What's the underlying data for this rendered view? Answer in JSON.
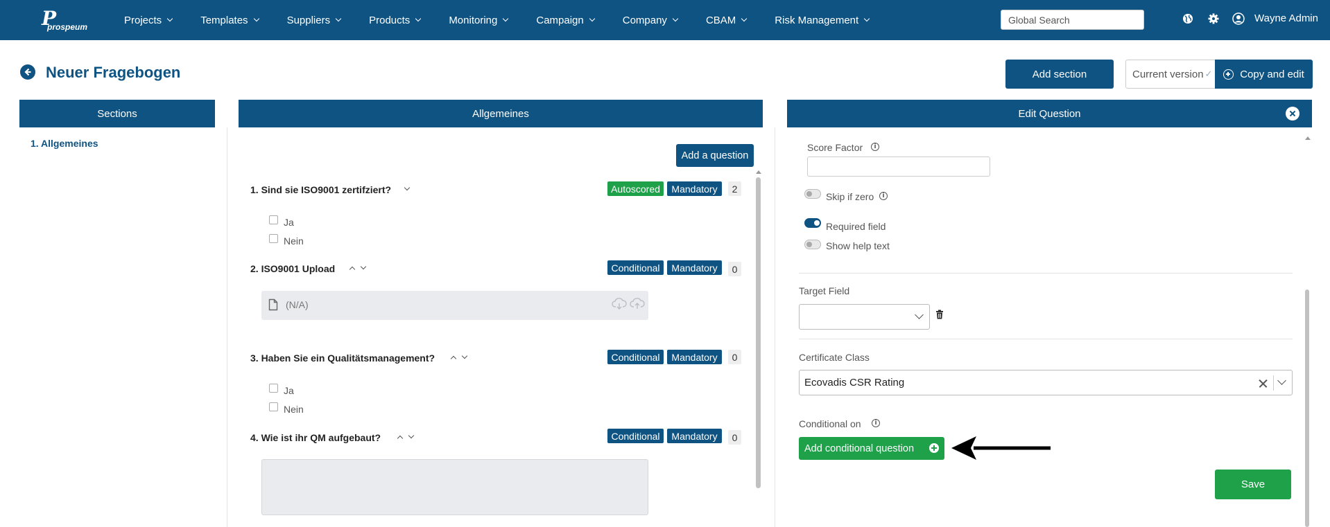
{
  "brand": {
    "logo_mark": "P",
    "logo_word": "prospeum"
  },
  "nav": {
    "items": [
      {
        "label": "Projects",
        "icon": "chevron-down-icon"
      },
      {
        "label": "Templates",
        "icon": "chevron-down-icon"
      },
      {
        "label": "Suppliers",
        "icon": "chevron-down-icon"
      },
      {
        "label": "Products",
        "icon": "chevron-down-icon"
      },
      {
        "label": "Monitoring",
        "icon": "chevron-down-icon"
      },
      {
        "label": "Campaign",
        "icon": "chevron-down-icon"
      },
      {
        "label": "Company",
        "icon": "chevron-down-icon"
      },
      {
        "label": "CBAM",
        "icon": "chevron-down-icon"
      },
      {
        "label": "Risk Management",
        "icon": "chevron-down-icon"
      }
    ],
    "search_placeholder": "Global Search",
    "icons": [
      "globe-icon",
      "gear-icon",
      "user-icon"
    ],
    "user_name": "Wayne Admin"
  },
  "header": {
    "title": "Neuer Fragebogen",
    "add_section_label": "Add section",
    "version_label": "Current version",
    "copy_edit_label": "Copy and edit"
  },
  "sections_panel": {
    "title": "Sections",
    "items": [
      {
        "label": "1. Allgemeines"
      }
    ]
  },
  "questions_panel": {
    "title": "Allgemeines",
    "add_question_label": "Add a question",
    "questions": [
      {
        "title": "1. Sind sie ISO9001 zertifziert?",
        "badges": [
          "Autoscored",
          "Mandatory"
        ],
        "count": "2",
        "options": [
          "Ja",
          "Nein"
        ]
      },
      {
        "title": "2. ISO9001 Upload",
        "badges": [
          "Conditional",
          "Mandatory"
        ],
        "count": "0",
        "upload_value": "(N/A)"
      },
      {
        "title": "3. Haben Sie ein Qualitätsmanagement?",
        "badges": [
          "Conditional",
          "Mandatory"
        ],
        "count": "0",
        "options": [
          "Ja",
          "Nein"
        ]
      },
      {
        "title": "4. Wie ist ihr QM aufgebaut?",
        "badges": [
          "Conditional",
          "Mandatory"
        ],
        "count": "0"
      }
    ]
  },
  "edit_panel": {
    "title": "Edit Question",
    "score_factor_label": "Score Factor",
    "score_factor_value": "",
    "skip_if_zero_label": "Skip if zero",
    "skip_if_zero": false,
    "required_field_label": "Required field",
    "required_field": true,
    "show_help_text_label": "Show help text",
    "show_help_text": false,
    "target_field_label": "Target Field",
    "target_field_value": "",
    "certificate_class_label": "Certificate Class",
    "certificate_class_value": "Ecovadis CSR Rating",
    "conditional_on_label": "Conditional on",
    "add_conditional_label": "Add conditional question",
    "save_label": "Save"
  },
  "colors": {
    "primary": "#0f5382",
    "success": "#1fa14a",
    "badge_count_bg": "#eeeeee"
  }
}
